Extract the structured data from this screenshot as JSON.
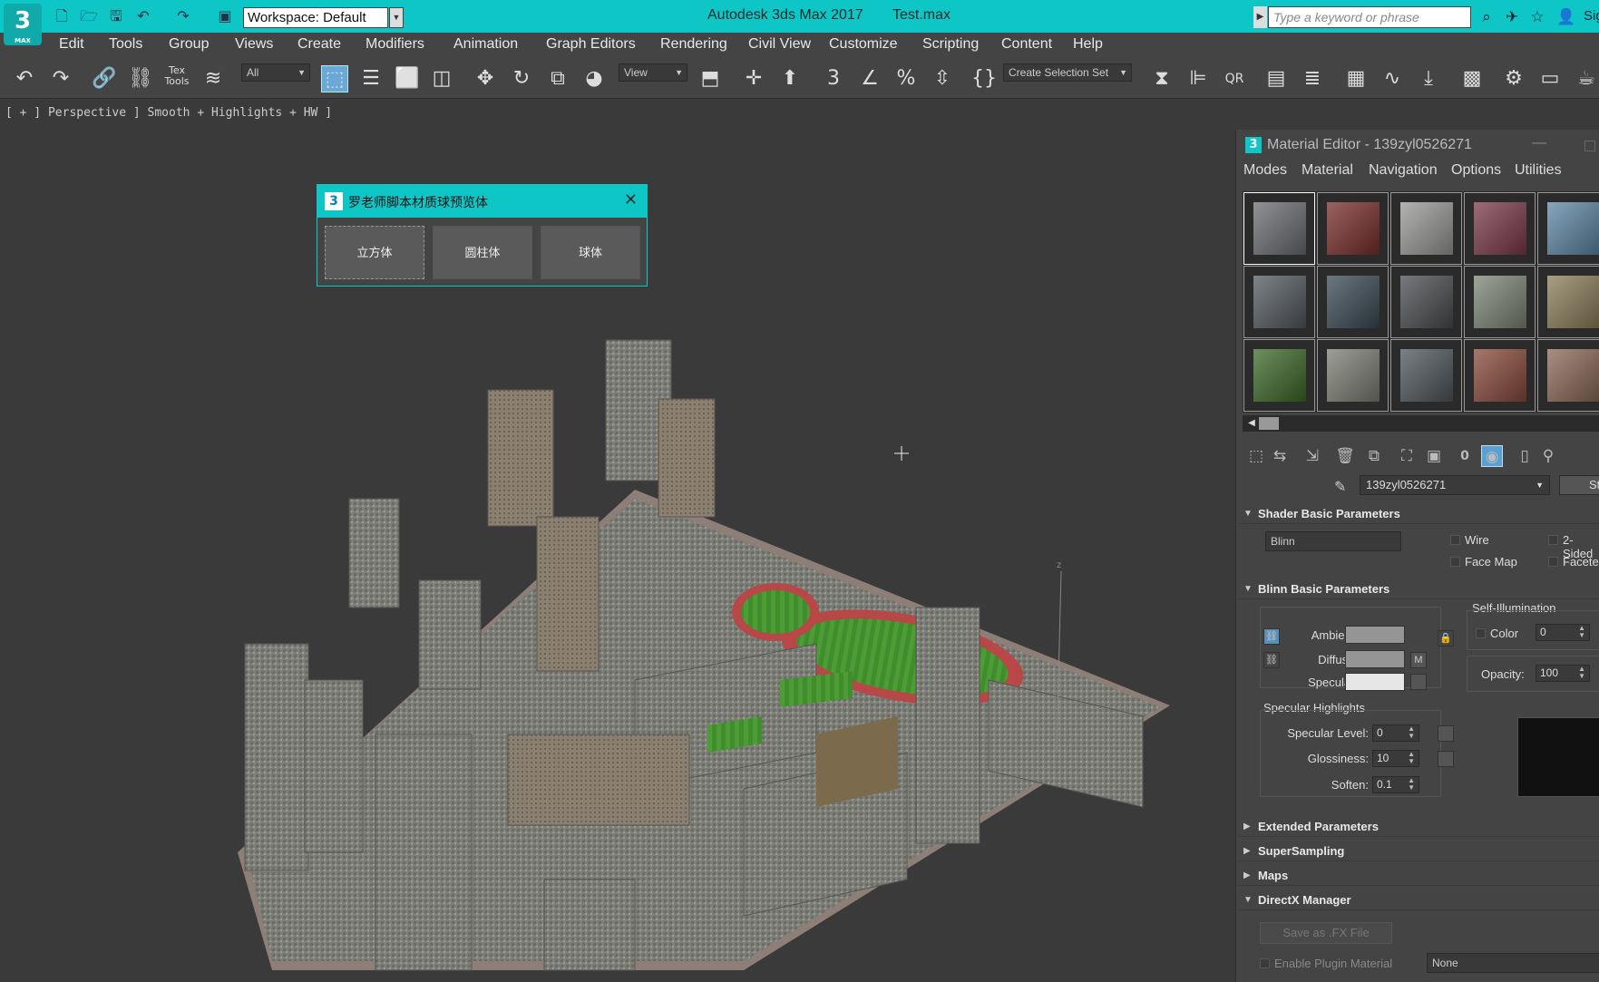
{
  "app": {
    "title": "Autodesk 3ds Max 2017",
    "file": "Test.max",
    "logo": "3",
    "logo_sub": "MAX",
    "workspace": "Workspace: Default",
    "search_placeholder": "Type a keyword or phrase",
    "signin": "Sig",
    "accent": "#0fc6c6"
  },
  "menu": [
    "Edit",
    "Tools",
    "Group",
    "Views",
    "Create",
    "Modifiers",
    "Animation",
    "Graph Editors",
    "Rendering",
    "Civil View",
    "Customize",
    "Scripting",
    "Content",
    "Help"
  ],
  "toolbar": {
    "filter": "All",
    "ref_coord": "View",
    "selection_set": "Create Selection Set"
  },
  "viewport": {
    "label": "[ + ] Perspective ] Smooth + Highlights + HW ]"
  },
  "script_dialog": {
    "title": "罗老师脚本材质球预览体",
    "buttons": [
      "立方体",
      "圆柱体",
      "球体"
    ]
  },
  "material_editor": {
    "title": "Material Editor - 139zyl0526271",
    "menu": [
      "Modes",
      "Material",
      "Navigation",
      "Options",
      "Utilities"
    ],
    "material_name": "139zyl0526271",
    "material_type": "Stan",
    "slot_colors": [
      "#6b6e72",
      "#7a2e2a",
      "#9a9a98",
      "#7c3a4a",
      "#5f88a6",
      "#545a60",
      "#3a4a55",
      "#4a4d50",
      "#7e8676",
      "#8c7f5a",
      "#3e6a28",
      "#7d7f74",
      "#50575d",
      "#8a4a3c",
      "#8c6a58"
    ],
    "rollouts": {
      "shader_basic": "Shader Basic Parameters",
      "blinn_basic": "Blinn Basic Parameters",
      "extended": "Extended Parameters",
      "supersampling": "SuperSampling",
      "maps": "Maps",
      "directx": "DirectX Manager"
    },
    "shader": {
      "type": "Blinn",
      "wire": "Wire",
      "two_sided": "2-Sided",
      "face_map": "Face Map",
      "faceted": "Faceted"
    },
    "blinn": {
      "ambient_label": "Ambient:",
      "diffuse_label": "Diffuse:",
      "specular_label": "Specular:",
      "ambient_color": "#959595",
      "diffuse_color": "#959595",
      "specular_color": "#e6e6e6",
      "m_button": "M",
      "self_illum_label": "Self-Illumination",
      "color_label": "Color",
      "self_illum_value": "0",
      "opacity_label": "Opacity:",
      "opacity_value": "100",
      "spec_highlights_label": "Specular Highlights",
      "spec_level_label": "Specular Level:",
      "spec_level": "0",
      "glossiness_label": "Glossiness:",
      "glossiness": "10",
      "soften_label": "Soften:",
      "soften": "0.1"
    },
    "directx": {
      "save_fx": "Save as .FX File",
      "enable_plugin": "Enable Plugin Material",
      "plugin_value": "None"
    }
  }
}
